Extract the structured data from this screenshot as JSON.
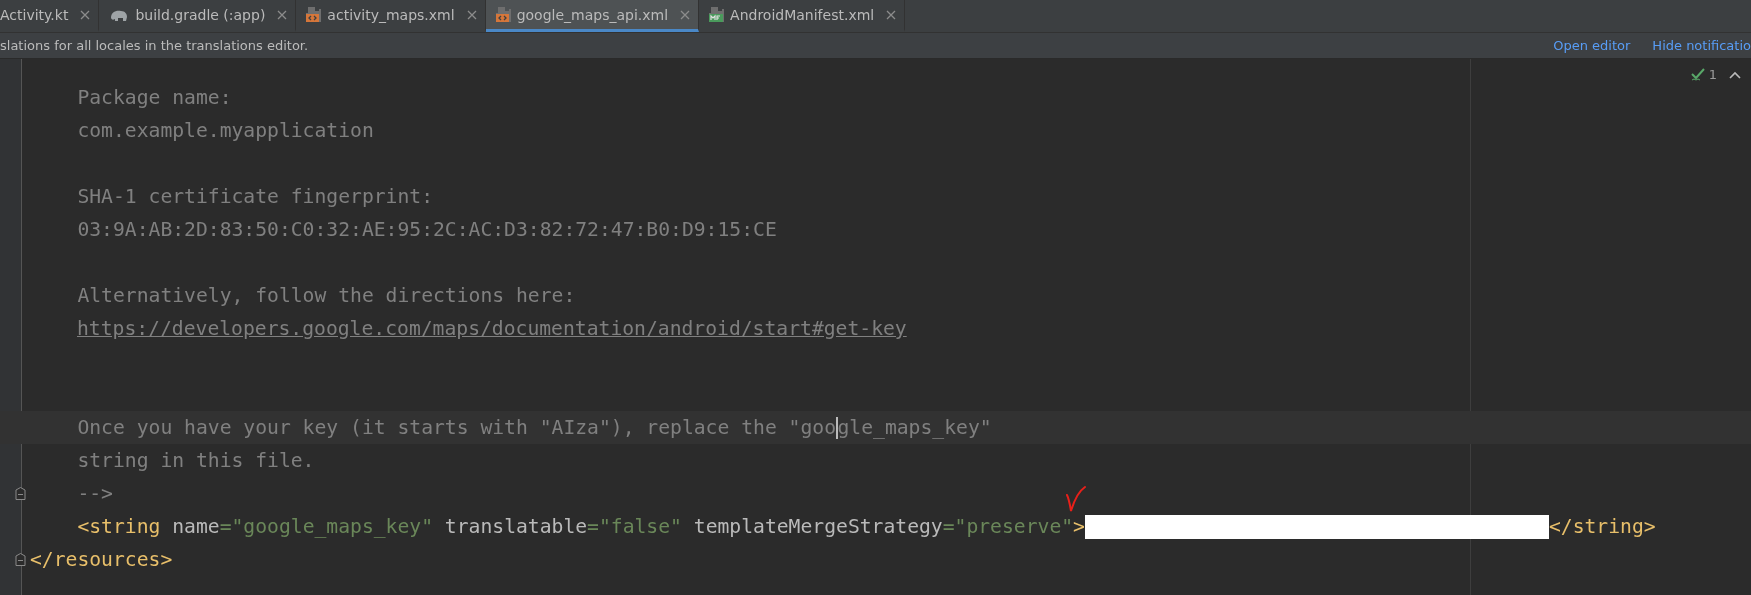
{
  "tabs": [
    {
      "label": "Activity.kt",
      "kind": "kotlin",
      "selected": false
    },
    {
      "label": "build.gradle (:app)",
      "kind": "gradle",
      "selected": false
    },
    {
      "label": "activity_maps.xml",
      "kind": "xml",
      "selected": false
    },
    {
      "label": "google_maps_api.xml",
      "kind": "xml",
      "selected": true
    },
    {
      "label": "AndroidManifest.xml",
      "kind": "manifest",
      "selected": false
    }
  ],
  "notification": {
    "text": "slations for all locales in the translations editor.",
    "actions": [
      "Open editor",
      "Hide notificatio"
    ]
  },
  "inspection": {
    "count": "1"
  },
  "editor": {
    "lines": [
      {
        "kind": "comment",
        "text": "    Package name:",
        "current": false,
        "fold": false
      },
      {
        "kind": "comment",
        "text": "    com.example.myapplication",
        "current": false,
        "fold": false
      },
      {
        "kind": "blank",
        "current": false,
        "fold": false
      },
      {
        "kind": "comment",
        "text": "    SHA-1 certificate fingerprint:",
        "current": false,
        "fold": false
      },
      {
        "kind": "comment",
        "text": "    03:9A:AB:2D:83:50:C0:32:AE:95:2C:AC:D3:82:72:47:B0:D9:15:CE",
        "current": false,
        "fold": false
      },
      {
        "kind": "blank",
        "current": false,
        "fold": false
      },
      {
        "kind": "comment",
        "text": "    Alternatively, follow the directions here:",
        "current": false,
        "fold": false
      },
      {
        "kind": "link",
        "text": "https://developers.google.com/maps/documentation/android/start#get-key",
        "current": false,
        "fold": false
      },
      {
        "kind": "blank",
        "current": false,
        "fold": false
      },
      {
        "kind": "blank",
        "current": false,
        "fold": false
      },
      {
        "kind": "comment",
        "text": "    Once you have your key (it starts with \"AIza\"), replace the \"goo",
        "after_caret": "gle_maps_key\"",
        "current": true,
        "fold": false
      },
      {
        "kind": "comment",
        "text": "    string in this file.",
        "current": false,
        "fold": false
      },
      {
        "kind": "comment",
        "text": "    -->",
        "current": false,
        "fold": true
      },
      {
        "kind": "code",
        "current": false,
        "fold": false,
        "segments": [
          {
            "kind": "code",
            "tokens": [
              {
                "kind": "tag",
                "text": "    <string"
              },
              {
                "kind": "attr",
                "text": " name"
              },
              {
                "kind": "value",
                "text": "=\"google_maps_key\""
              },
              {
                "kind": "attr",
                "text": " translatable"
              },
              {
                "kind": "value",
                "text": "=\"false\""
              },
              {
                "kind": "attr",
                "text": " templateMergeStrategy"
              },
              {
                "kind": "value",
                "text": "=\"preserve\""
              },
              {
                "kind": "tag",
                "text": ">"
              }
            ]
          },
          {
            "kind": "redacted"
          },
          {
            "kind": "code",
            "tokens": [
              {
                "kind": "tag",
                "text": "</string>"
              }
            ]
          }
        ]
      },
      {
        "kind": "code",
        "current": false,
        "fold": true,
        "segments": [
          {
            "kind": "code",
            "tokens": [
              {
                "kind": "tag",
                "text": "</resources>"
              }
            ]
          }
        ]
      }
    ]
  }
}
